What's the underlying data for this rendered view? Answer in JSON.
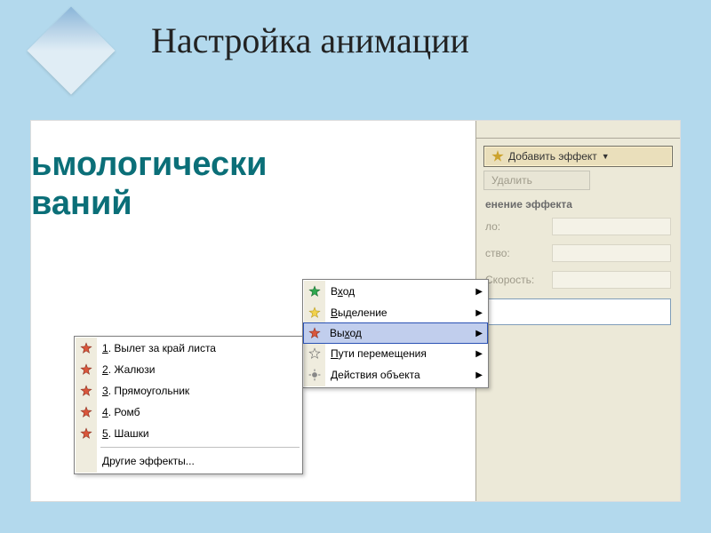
{
  "title": "Настройка анимации",
  "slide": {
    "line1": "ьмологически",
    "line2": "ваний"
  },
  "taskpane": {
    "add_effect": "Добавить эффект",
    "remove": "Удалить",
    "section": "енение эффекта",
    "field_start": "ло:",
    "field_property": "ство:",
    "field_speed": "Скорость:"
  },
  "menu_categories": [
    {
      "label": "Вход",
      "u": 1,
      "icon": "star-green"
    },
    {
      "label": "Выделение",
      "u": 0,
      "icon": "star-yellow"
    },
    {
      "label": "Выход",
      "u": 2,
      "icon": "star-red",
      "hover": true
    },
    {
      "label": "Пути перемещения",
      "u": 0,
      "icon": "star-outline"
    },
    {
      "label": "Действия объекта",
      "u": 0,
      "icon": "gear"
    }
  ],
  "menu_exit_effects": [
    {
      "num": "1",
      "label": "Вылет за край листа"
    },
    {
      "num": "2",
      "label": "Жалюзи"
    },
    {
      "num": "3",
      "label": "Прямоугольник"
    },
    {
      "num": "4",
      "label": "Ромб"
    },
    {
      "num": "5",
      "label": "Шашки"
    }
  ],
  "menu_exit_more": "Другие эффекты..."
}
